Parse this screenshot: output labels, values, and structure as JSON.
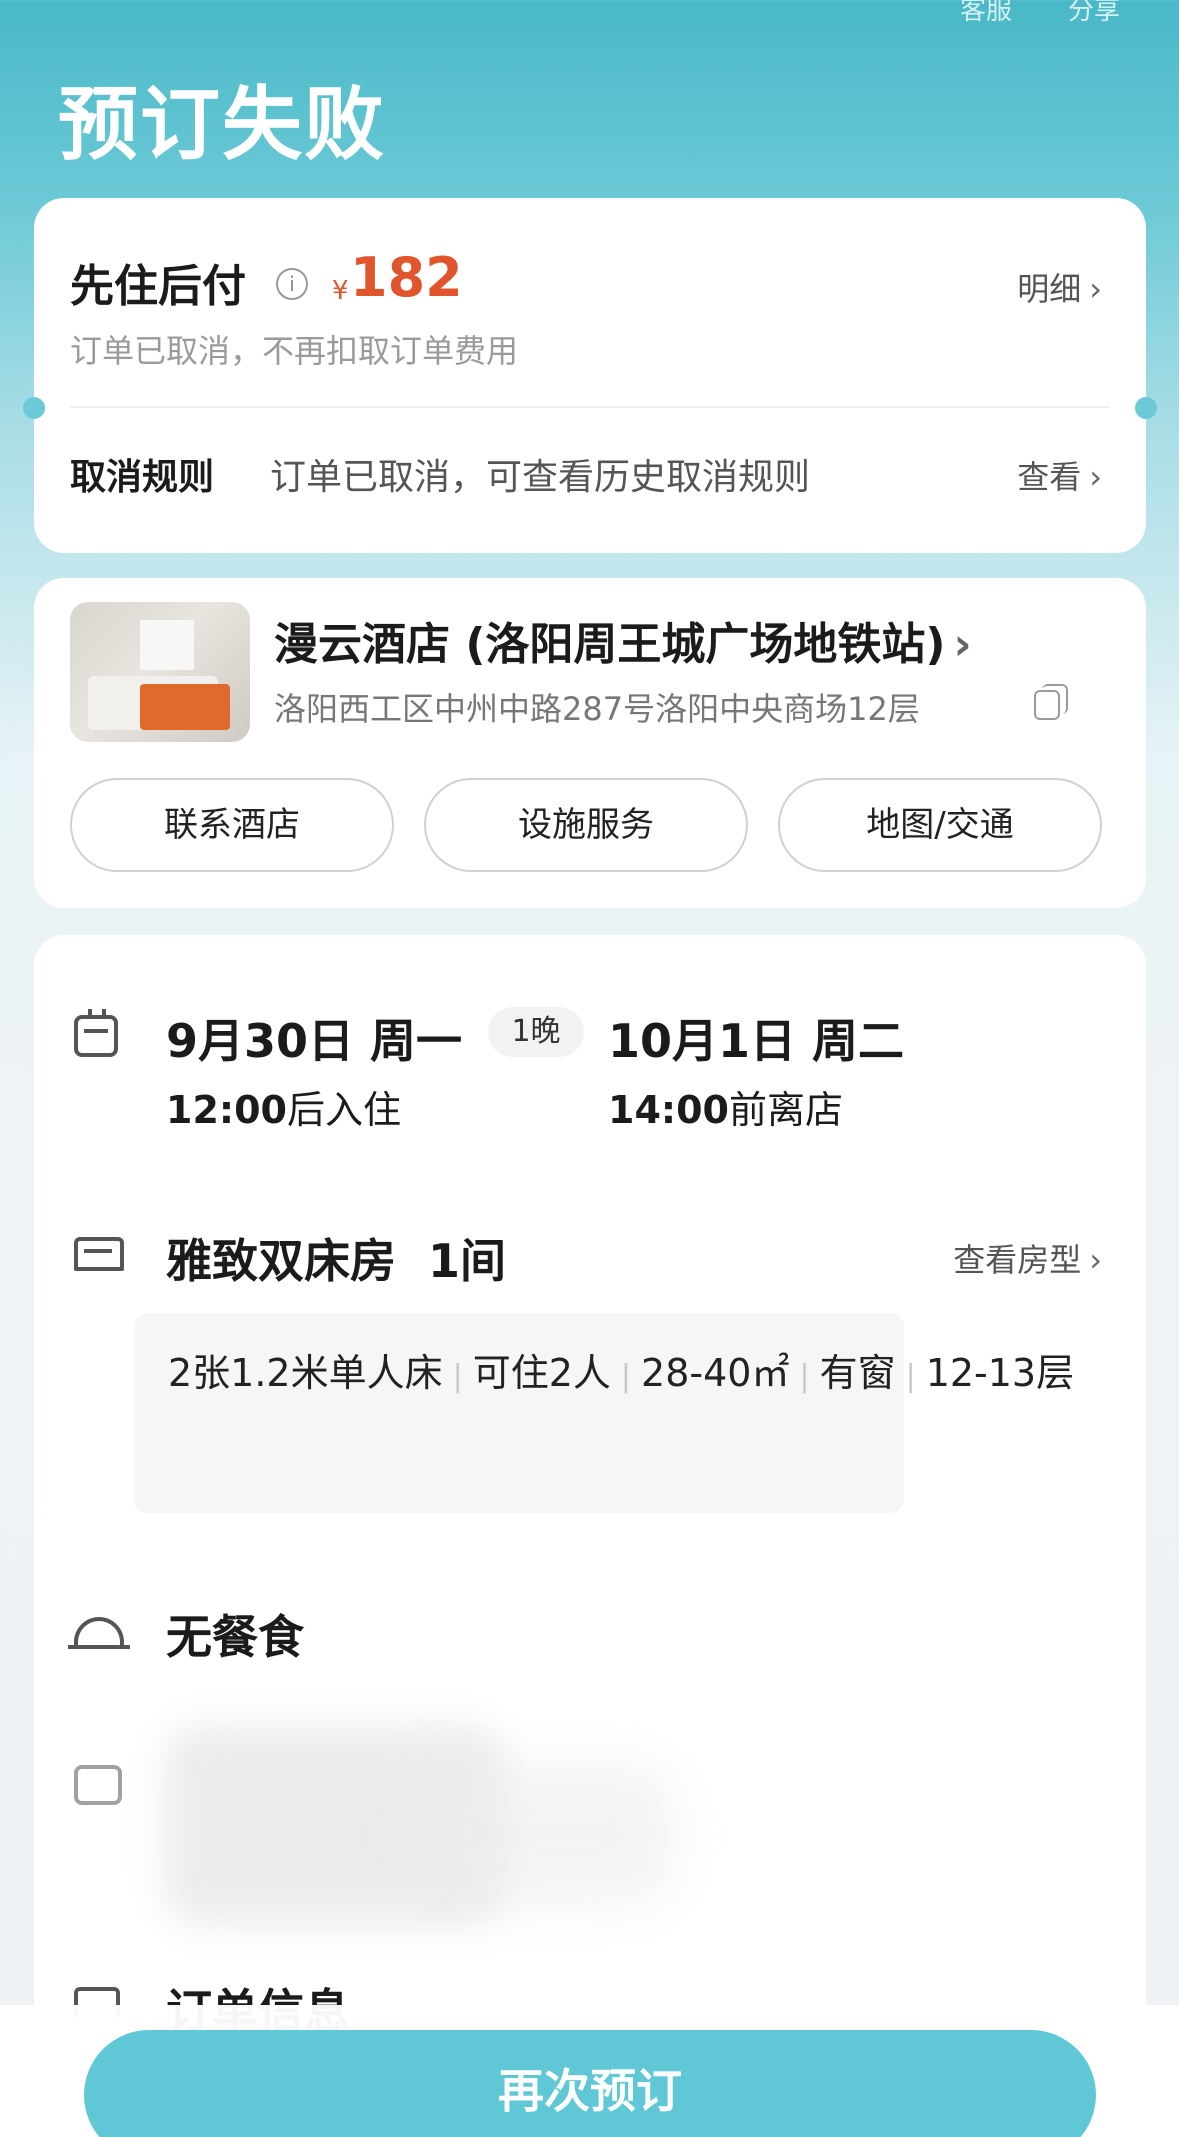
{
  "header": {
    "title": "预订失败",
    "action_left": "客服",
    "action_right": "分享"
  },
  "payment": {
    "title": "先住后付",
    "currency": "¥",
    "amount": "182",
    "detail_link": "明细",
    "subtitle": "订单已取消，不再扣取订单费用",
    "rule_label": "取消规则",
    "rule_text": "订单已取消，可查看历史取消规则",
    "rule_link": "查看"
  },
  "hotel": {
    "name": "漫云酒店 (洛阳周王城广场地铁站)",
    "address": "洛阳西工区中州中路287号洛阳中央商场12层",
    "buttons": [
      "联系酒店",
      "设施服务",
      "地图/交通"
    ]
  },
  "stay": {
    "checkin_date": "9月30日 周一",
    "nights": "1晚",
    "checkout_date": "10月1日 周二",
    "checkin_time": "12:00",
    "checkin_suffix": "后入住",
    "checkout_time": "14:00",
    "checkout_suffix": "前离店"
  },
  "room": {
    "name": "雅致双床房  1间",
    "view_link": "查看房型",
    "specs": [
      "2张1.2米单人床",
      "可住2人",
      "28-40㎡",
      "有窗",
      "12-13层"
    ]
  },
  "meal": {
    "text": "无餐食"
  },
  "order": {
    "title": "订单信息"
  },
  "footer": {
    "rebook": "再次预订"
  },
  "icons": [
    "calendar-icon",
    "bed-icon",
    "meal-bell-icon",
    "id-card-icon",
    "order-icon",
    "info-icon",
    "copy-icon",
    "chevron-right-icon"
  ]
}
